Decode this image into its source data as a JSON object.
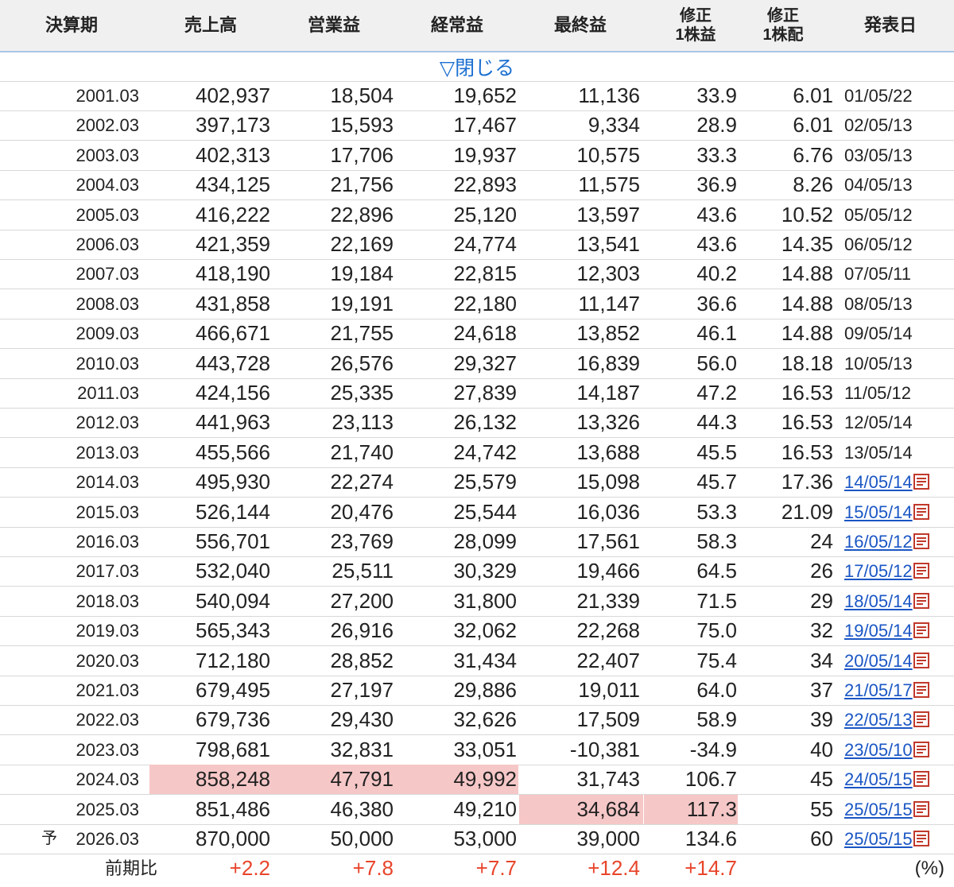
{
  "header": {
    "cols": [
      {
        "label": "決算期"
      },
      {
        "label": "売上高"
      },
      {
        "label": "営業益"
      },
      {
        "label": "経常益"
      },
      {
        "label": "最終益"
      },
      {
        "line1": "修正",
        "line2": "1株益"
      },
      {
        "line1": "修正",
        "line2": "1株配"
      },
      {
        "label": "発表日"
      }
    ]
  },
  "toggle_label": "▽閉じる",
  "rows": [
    {
      "period": "2001.03",
      "sales": "402,937",
      "op": "18,504",
      "ord": "19,652",
      "net": "11,136",
      "eps": "33.9",
      "dps": "6.01",
      "date": "01/05/22",
      "link": false
    },
    {
      "period": "2002.03",
      "sales": "397,173",
      "op": "15,593",
      "ord": "17,467",
      "net": "9,334",
      "eps": "28.9",
      "dps": "6.01",
      "date": "02/05/13",
      "link": false
    },
    {
      "period": "2003.03",
      "sales": "402,313",
      "op": "17,706",
      "ord": "19,937",
      "net": "10,575",
      "eps": "33.3",
      "dps": "6.76",
      "date": "03/05/13",
      "link": false
    },
    {
      "period": "2004.03",
      "sales": "434,125",
      "op": "21,756",
      "ord": "22,893",
      "net": "11,575",
      "eps": "36.9",
      "dps": "8.26",
      "date": "04/05/13",
      "link": false
    },
    {
      "period": "2005.03",
      "sales": "416,222",
      "op": "22,896",
      "ord": "25,120",
      "net": "13,597",
      "eps": "43.6",
      "dps": "10.52",
      "date": "05/05/12",
      "link": false
    },
    {
      "period": "2006.03",
      "sales": "421,359",
      "op": "22,169",
      "ord": "24,774",
      "net": "13,541",
      "eps": "43.6",
      "dps": "14.35",
      "date": "06/05/12",
      "link": false
    },
    {
      "period": "2007.03",
      "sales": "418,190",
      "op": "19,184",
      "ord": "22,815",
      "net": "12,303",
      "eps": "40.2",
      "dps": "14.88",
      "date": "07/05/11",
      "link": false
    },
    {
      "period": "2008.03",
      "sales": "431,858",
      "op": "19,191",
      "ord": "22,180",
      "net": "11,147",
      "eps": "36.6",
      "dps": "14.88",
      "date": "08/05/13",
      "link": false
    },
    {
      "period": "2009.03",
      "sales": "466,671",
      "op": "21,755",
      "ord": "24,618",
      "net": "13,852",
      "eps": "46.1",
      "dps": "14.88",
      "date": "09/05/14",
      "link": false
    },
    {
      "period": "2010.03",
      "sales": "443,728",
      "op": "26,576",
      "ord": "29,327",
      "net": "16,839",
      "eps": "56.0",
      "dps": "18.18",
      "date": "10/05/13",
      "link": false
    },
    {
      "period": "2011.03",
      "sales": "424,156",
      "op": "25,335",
      "ord": "27,839",
      "net": "14,187",
      "eps": "47.2",
      "dps": "16.53",
      "date": "11/05/12",
      "link": false
    },
    {
      "period": "2012.03",
      "sales": "441,963",
      "op": "23,113",
      "ord": "26,132",
      "net": "13,326",
      "eps": "44.3",
      "dps": "16.53",
      "date": "12/05/14",
      "link": false
    },
    {
      "period": "2013.03",
      "sales": "455,566",
      "op": "21,740",
      "ord": "24,742",
      "net": "13,688",
      "eps": "45.5",
      "dps": "16.53",
      "date": "13/05/14",
      "link": false
    },
    {
      "period": "2014.03",
      "sales": "495,930",
      "op": "22,274",
      "ord": "25,579",
      "net": "15,098",
      "eps": "45.7",
      "dps": "17.36",
      "date": "14/05/14",
      "link": true
    },
    {
      "period": "2015.03",
      "sales": "526,144",
      "op": "20,476",
      "ord": "25,544",
      "net": "16,036",
      "eps": "53.3",
      "dps": "21.09",
      "date": "15/05/14",
      "link": true
    },
    {
      "period": "2016.03",
      "sales": "556,701",
      "op": "23,769",
      "ord": "28,099",
      "net": "17,561",
      "eps": "58.3",
      "dps": "24",
      "date": "16/05/12",
      "link": true
    },
    {
      "period": "2017.03",
      "sales": "532,040",
      "op": "25,511",
      "ord": "30,329",
      "net": "19,466",
      "eps": "64.5",
      "dps": "26",
      "date": "17/05/12",
      "link": true
    },
    {
      "period": "2018.03",
      "sales": "540,094",
      "op": "27,200",
      "ord": "31,800",
      "net": "21,339",
      "eps": "71.5",
      "dps": "29",
      "date": "18/05/14",
      "link": true
    },
    {
      "period": "2019.03",
      "sales": "565,343",
      "op": "26,916",
      "ord": "32,062",
      "net": "22,268",
      "eps": "75.0",
      "dps": "32",
      "date": "19/05/14",
      "link": true
    },
    {
      "period": "2020.03",
      "sales": "712,180",
      "op": "28,852",
      "ord": "31,434",
      "net": "22,407",
      "eps": "75.4",
      "dps": "34",
      "date": "20/05/14",
      "link": true
    },
    {
      "period": "2021.03",
      "sales": "679,495",
      "op": "27,197",
      "ord": "29,886",
      "net": "19,011",
      "eps": "64.0",
      "dps": "37",
      "date": "21/05/17",
      "link": true
    },
    {
      "period": "2022.03",
      "sales": "679,736",
      "op": "29,430",
      "ord": "32,626",
      "net": "17,509",
      "eps": "58.9",
      "dps": "39",
      "date": "22/05/13",
      "link": true
    },
    {
      "period": "2023.03",
      "sales": "798,681",
      "op": "32,831",
      "ord": "33,051",
      "net": "-10,381",
      "eps": "-34.9",
      "dps": "40",
      "date": "23/05/10",
      "link": true
    },
    {
      "period": "2024.03",
      "sales": "858,248",
      "op": "47,791",
      "ord": "49,992",
      "net": "31,743",
      "eps": "106.7",
      "dps": "45",
      "date": "24/05/15",
      "link": true,
      "hl": [
        "sales",
        "op",
        "ord"
      ]
    },
    {
      "period": "2025.03",
      "sales": "851,486",
      "op": "46,380",
      "ord": "49,210",
      "net": "34,684",
      "eps": "117.3",
      "dps": "55",
      "date": "25/05/15",
      "link": true,
      "hl": [
        "net",
        "eps"
      ]
    },
    {
      "period": "2026.03",
      "sales": "870,000",
      "op": "50,000",
      "ord": "53,000",
      "net": "39,000",
      "eps": "134.6",
      "dps": "60",
      "date": "25/05/15",
      "link": true,
      "forecast": "予"
    }
  ],
  "yoy": {
    "label": "前期比",
    "sales": "+2.2",
    "op": "+7.8",
    "ord": "+7.7",
    "net": "+12.4",
    "eps": "+14.7",
    "unit": "(%)"
  },
  "icons": {
    "pdf": "pdf-icon"
  },
  "colors": {
    "header_bg": "#f0f0f0",
    "link": "#1a56c4",
    "highlight": "#f6c7c7",
    "positive": "#e8452b"
  }
}
